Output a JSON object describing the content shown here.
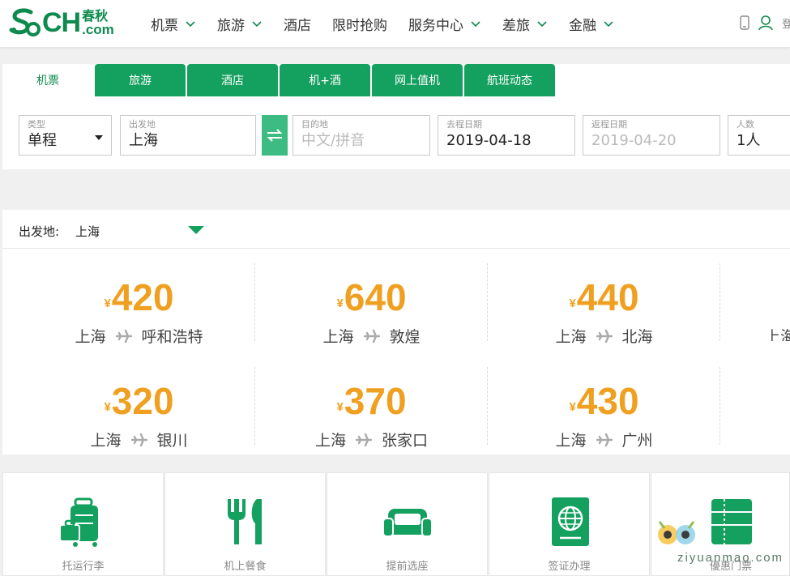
{
  "logo": {
    "brand": "CH",
    "cn": "春秋",
    "domain": ".com"
  },
  "nav": [
    {
      "label": "机票",
      "dropdown": true
    },
    {
      "label": "旅游",
      "dropdown": true
    },
    {
      "label": "酒店",
      "dropdown": false
    },
    {
      "label": "限时抢购",
      "dropdown": false
    },
    {
      "label": "服务中心",
      "dropdown": true
    },
    {
      "label": "差旅",
      "dropdown": true
    },
    {
      "label": "金融",
      "dropdown": true
    }
  ],
  "header_right": {
    "login_partial": "登"
  },
  "tabs": [
    "机票",
    "旅游",
    "酒店",
    "机+酒",
    "网上值机",
    "航班动态"
  ],
  "search": {
    "type": {
      "label": "类型",
      "value": "单程"
    },
    "origin": {
      "label": "出发地",
      "value": "上海"
    },
    "destination": {
      "label": "目的地",
      "placeholder": "中文/拼音"
    },
    "depart_date": {
      "label": "去程日期",
      "value": "2019-04-18"
    },
    "return_date": {
      "label": "返程日期",
      "placeholder": "2019-04-20"
    },
    "passengers": {
      "label": "人数",
      "value": "1人"
    }
  },
  "deals": {
    "origin_label": "出发地:",
    "origin_value": "上海",
    "currency": "¥",
    "items": [
      {
        "price": "420",
        "from": "上海",
        "to": "呼和浩特"
      },
      {
        "price": "640",
        "from": "上海",
        "to": "敦煌"
      },
      {
        "price": "440",
        "from": "上海",
        "to": "北海"
      },
      {
        "price": "",
        "from": "上海",
        "to": ""
      },
      {
        "price": "320",
        "from": "上海",
        "to": "银川"
      },
      {
        "price": "370",
        "from": "上海",
        "to": "张家口"
      },
      {
        "price": "430",
        "from": "上海",
        "to": "广州"
      },
      {
        "price": "",
        "from": "",
        "to": ""
      }
    ]
  },
  "services": [
    {
      "name": "托运行李",
      "icon": "luggage-icon"
    },
    {
      "name": "机上餐食",
      "icon": "meal-icon"
    },
    {
      "name": "提前选座",
      "icon": "seat-icon"
    },
    {
      "name": "签证办理",
      "icon": "visa-icon"
    },
    {
      "name": "優惠门票",
      "icon": "ticket-icon"
    }
  ],
  "watermark": "ziyuanmao.com",
  "colors": {
    "brand": "#0f8a4f",
    "tab": "#14a05e",
    "swap": "#3cbc82",
    "price": "#f0a021"
  }
}
